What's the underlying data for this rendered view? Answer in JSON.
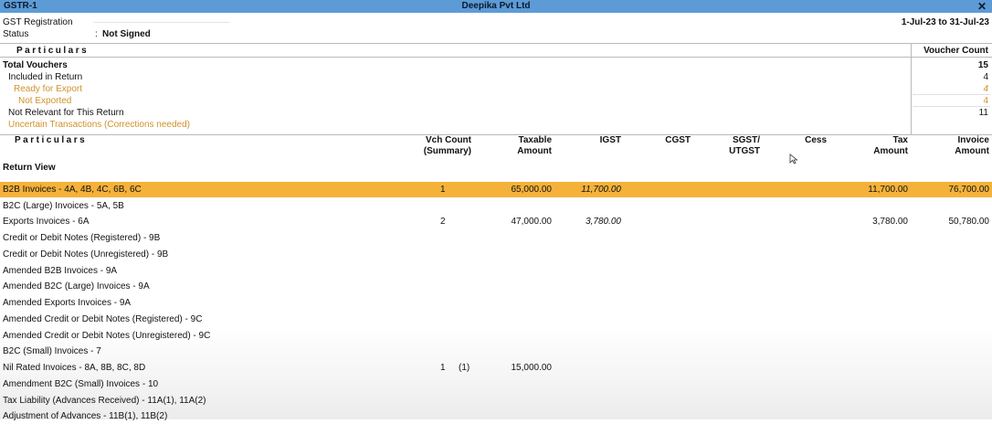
{
  "titlebar": {
    "left": "GSTR-1",
    "center": "Deepika Pvt Ltd",
    "close": "✕"
  },
  "header": {
    "gst_label": "GST Registration",
    "status_label": "Status",
    "status_colon": ":",
    "status_value": "Not Signed",
    "period": "1-Jul-23 to 31-Jul-23"
  },
  "summary": {
    "particulars_label": "Particulars",
    "voucher_count_label": "Voucher Count",
    "rows": [
      {
        "label": "Total Vouchers",
        "value": "15"
      },
      {
        "label": "Included in Return",
        "value": "4"
      },
      {
        "label": "Ready for Export",
        "value": "4"
      },
      {
        "label": "Not Exported",
        "value": "4"
      },
      {
        "label": "Not Relevant for This Return",
        "value": "11"
      },
      {
        "label": "Uncertain Transactions (Corrections needed)",
        "value": ""
      }
    ]
  },
  "columns": {
    "particulars": "Particulars",
    "vch_count": "Vch Count",
    "vch_count_sub": "(Summary)",
    "taxable": "Taxable",
    "taxable_sub": "Amount",
    "igst": "IGST",
    "cgst": "CGST",
    "sgst": "SGST/",
    "sgst_sub": "UTGST",
    "cess": "Cess",
    "tax": "Tax",
    "tax_sub": "Amount",
    "invoice": "Invoice",
    "invoice_sub": "Amount"
  },
  "return_view_label": "Return View",
  "rows": [
    {
      "name": "B2B Invoices - 4A, 4B, 4C, 6B, 6C",
      "vch": "1",
      "vch2": "",
      "taxable": "65,000.00",
      "igst": "11,700.00",
      "tax": "11,700.00",
      "invoice": "76,700.00"
    },
    {
      "name": "B2C (Large) Invoices - 5A, 5B",
      "vch": "",
      "vch2": "",
      "taxable": "",
      "igst": "",
      "tax": "",
      "invoice": ""
    },
    {
      "name": "Exports Invoices - 6A",
      "vch": "2",
      "vch2": "",
      "taxable": "47,000.00",
      "igst": "3,780.00",
      "tax": "3,780.00",
      "invoice": "50,780.00"
    },
    {
      "name": "Credit or Debit Notes (Registered) - 9B",
      "vch": "",
      "vch2": "",
      "taxable": "",
      "igst": "",
      "tax": "",
      "invoice": ""
    },
    {
      "name": "Credit or Debit Notes (Unregistered) - 9B",
      "vch": "",
      "vch2": "",
      "taxable": "",
      "igst": "",
      "tax": "",
      "invoice": ""
    },
    {
      "name": "Amended B2B Invoices - 9A",
      "vch": "",
      "vch2": "",
      "taxable": "",
      "igst": "",
      "tax": "",
      "invoice": ""
    },
    {
      "name": "Amended B2C (Large) Invoices - 9A",
      "vch": "",
      "vch2": "",
      "taxable": "",
      "igst": "",
      "tax": "",
      "invoice": ""
    },
    {
      "name": "Amended Exports Invoices - 9A",
      "vch": "",
      "vch2": "",
      "taxable": "",
      "igst": "",
      "tax": "",
      "invoice": ""
    },
    {
      "name": "Amended Credit or Debit Notes (Registered) - 9C",
      "vch": "",
      "vch2": "",
      "taxable": "",
      "igst": "",
      "tax": "",
      "invoice": ""
    },
    {
      "name": "Amended Credit or Debit Notes (Unregistered) - 9C",
      "vch": "",
      "vch2": "",
      "taxable": "",
      "igst": "",
      "tax": "",
      "invoice": ""
    },
    {
      "name": "B2C (Small) Invoices - 7",
      "vch": "",
      "vch2": "",
      "taxable": "",
      "igst": "",
      "tax": "",
      "invoice": ""
    },
    {
      "name": "Nil Rated Invoices - 8A, 8B, 8C, 8D",
      "vch": "1",
      "vch2": "(1)",
      "taxable": "15,000.00",
      "igst": "",
      "tax": "",
      "invoice": ""
    },
    {
      "name": "Amendment B2C (Small) Invoices - 10",
      "vch": "",
      "vch2": "",
      "taxable": "",
      "igst": "",
      "tax": "",
      "invoice": ""
    },
    {
      "name": "Tax Liability (Advances Received) - 11A(1), 11A(2)",
      "vch": "",
      "vch2": "",
      "taxable": "",
      "igst": "",
      "tax": "",
      "invoice": ""
    },
    {
      "name": "Adjustment of Advances - 11B(1), 11B(2)",
      "vch": "",
      "vch2": "",
      "taxable": "",
      "igst": "",
      "tax": "",
      "invoice": ""
    }
  ],
  "colors": {
    "titlebar": "#5d9bd7",
    "highlight": "#f4b23a",
    "orange_text": "#d1922a"
  }
}
